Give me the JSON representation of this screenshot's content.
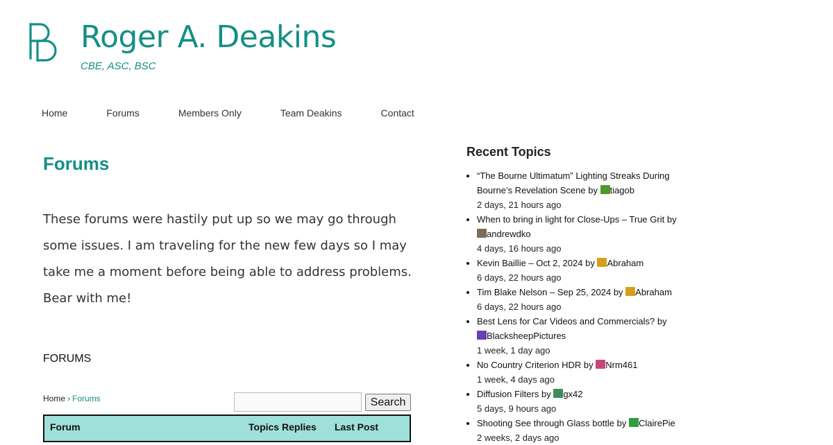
{
  "header": {
    "title": "Roger A. Deakins",
    "tagline": "CBE, ASC, BSC",
    "logo_color": "#148f86"
  },
  "nav": {
    "items": [
      {
        "label": "Home"
      },
      {
        "label": "Forums"
      },
      {
        "label": "Members Only"
      },
      {
        "label": "Team Deakins"
      },
      {
        "label": "Contact"
      }
    ]
  },
  "main": {
    "title": "Forums",
    "intro": "These forums were hastily put up so we may go through some issues. I am traveling for the new few days so I may take me a moment before being able to address problems. Bear with me!",
    "forums_heading": "FORUMS",
    "breadcrumb": {
      "home": "Home",
      "separator": "›",
      "current": "Forums"
    },
    "search": {
      "button_label": "Search",
      "value": "",
      "placeholder": ""
    },
    "table": {
      "header_bg": "#9fe0da",
      "columns": [
        "Forum",
        "Topics",
        "Replies",
        "Last Post"
      ]
    }
  },
  "sidebar": {
    "title": "Recent Topics",
    "by_word": "by",
    "topics": [
      {
        "title": "“The Bourne Ultimatum” Lighting Streaks During Bourne’s Revelation Scene",
        "author": "tiagob",
        "time": "2 days, 21 hours ago",
        "avatar_color": "#4c9a2a"
      },
      {
        "title": "When to bring in light for Close-Ups – True Grit",
        "author": "andrewdko",
        "time": "4 days, 16 hours ago",
        "avatar_color": "#7a6e5a"
      },
      {
        "title": "Kevin Baillie – Oct 2, 2024",
        "author": "Abraham",
        "time": "6 days, 22 hours ago",
        "avatar_color": "#d4a017"
      },
      {
        "title": "Tim Blake Nelson – Sep 25, 2024",
        "author": "Abraham",
        "time": "6 days, 22 hours ago",
        "avatar_color": "#d4a017"
      },
      {
        "title": "Best Lens for Car Videos and Commercials?",
        "author": "BlacksheepPictures",
        "time": "1 week, 1 day ago",
        "avatar_color": "#6a3fb5"
      },
      {
        "title": "No Country Criterion HDR",
        "author": "Nrm461",
        "time": "1 week, 4 days ago",
        "avatar_color": "#c8457c"
      },
      {
        "title": "Diffusion Filters",
        "author": "gx42",
        "time": "5 days, 9 hours ago",
        "avatar_color": "#3d8c5c"
      },
      {
        "title": "Shooting See through Glass bottle",
        "author": "ClairePie",
        "time": "2 weeks, 2 days ago",
        "avatar_color": "#2e9e3a"
      }
    ]
  }
}
